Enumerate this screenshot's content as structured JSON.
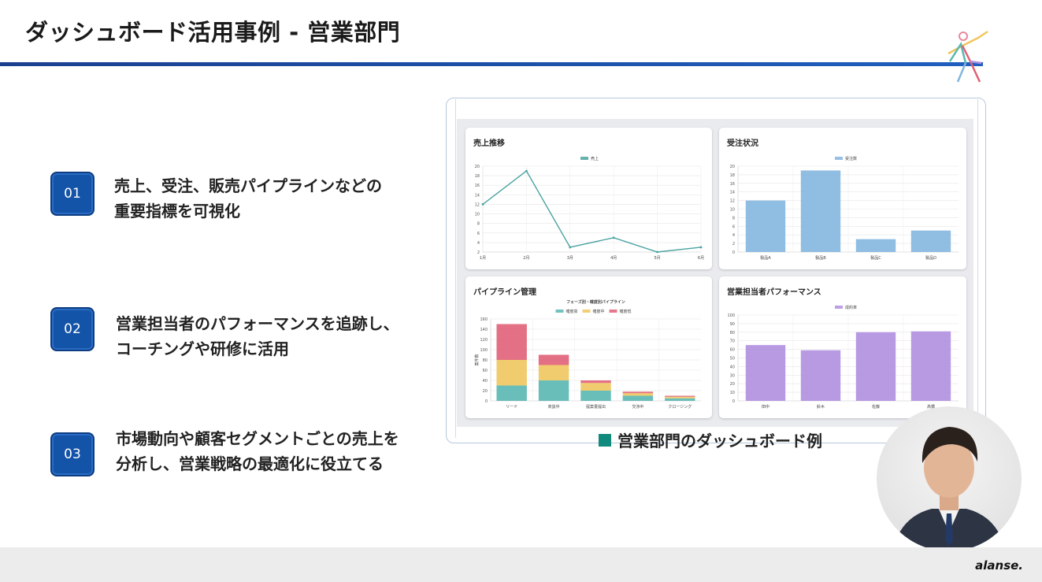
{
  "slide": {
    "title": "ダッシュボード活用事例 - 営業部門",
    "points": [
      {
        "number": "01",
        "lines": [
          "売上、受注、販売パイプラインなどの",
          "重要指標を可視化"
        ]
      },
      {
        "number": "02",
        "lines": [
          "営業担当者のパフォーマンスを追跡し、",
          "コーチングや研修に活用"
        ]
      },
      {
        "number": "03",
        "lines": [
          "市場動向や顧客セグメントごとの売上を",
          "分析し、営業戦略の最適化に役立てる"
        ]
      }
    ],
    "caption": "営業部門のダッシュボード例",
    "brand": "alanse."
  },
  "chart_data": [
    {
      "type": "line",
      "title": "売上推移",
      "categories": [
        "1月",
        "2月",
        "3月",
        "4月",
        "5月",
        "6月"
      ],
      "series": [
        {
          "name": "売上",
          "values": [
            12,
            19,
            3,
            5,
            2,
            3
          ]
        }
      ],
      "ylim": [
        2,
        20
      ],
      "yticks": [
        2,
        4,
        6,
        8,
        10,
        12,
        14,
        16,
        18,
        20
      ],
      "color": "#4aa3a0",
      "legend": "top"
    },
    {
      "type": "bar",
      "title": "受注状況",
      "categories": [
        "製品A",
        "製品B",
        "製品C",
        "製品D"
      ],
      "series": [
        {
          "name": "受注数",
          "values": [
            12,
            19,
            3,
            5
          ]
        }
      ],
      "ylim": [
        0,
        20
      ],
      "yticks": [
        0,
        2,
        4,
        6,
        8,
        10,
        12,
        14,
        16,
        18,
        20
      ],
      "color": "#84b6df",
      "legend": "top"
    },
    {
      "type": "bar",
      "stacked": true,
      "title": "パイプライン管理",
      "subtitle": "フェーズ別・確度別パイプライン",
      "ylabel": "案件数",
      "categories": [
        "リード",
        "商談中",
        "提案書提出",
        "交渉中",
        "クロージング"
      ],
      "series": [
        {
          "name": "確度高",
          "values": [
            30,
            40,
            20,
            10,
            5
          ],
          "color": "#5ab7b2"
        },
        {
          "name": "確度中",
          "values": [
            50,
            30,
            15,
            5,
            3
          ],
          "color": "#f0c65e"
        },
        {
          "name": "確度低",
          "values": [
            70,
            20,
            5,
            3,
            2
          ],
          "color": "#e06077"
        }
      ],
      "ylim": [
        0,
        160
      ],
      "yticks": [
        0,
        20,
        40,
        60,
        80,
        100,
        120,
        140,
        160
      ],
      "legend": "top"
    },
    {
      "type": "bar",
      "title": "営業担当者パフォーマンス",
      "categories": [
        "田中",
        "鈴木",
        "佐藤",
        "高橋"
      ],
      "series": [
        {
          "name": "成約率",
          "values": [
            65,
            59,
            80,
            81
          ]
        }
      ],
      "ylim": [
        0,
        100
      ],
      "yticks": [
        0,
        10,
        20,
        30,
        40,
        50,
        60,
        70,
        80,
        90,
        100
      ],
      "color": "#b08fe0",
      "legend": "top"
    }
  ]
}
